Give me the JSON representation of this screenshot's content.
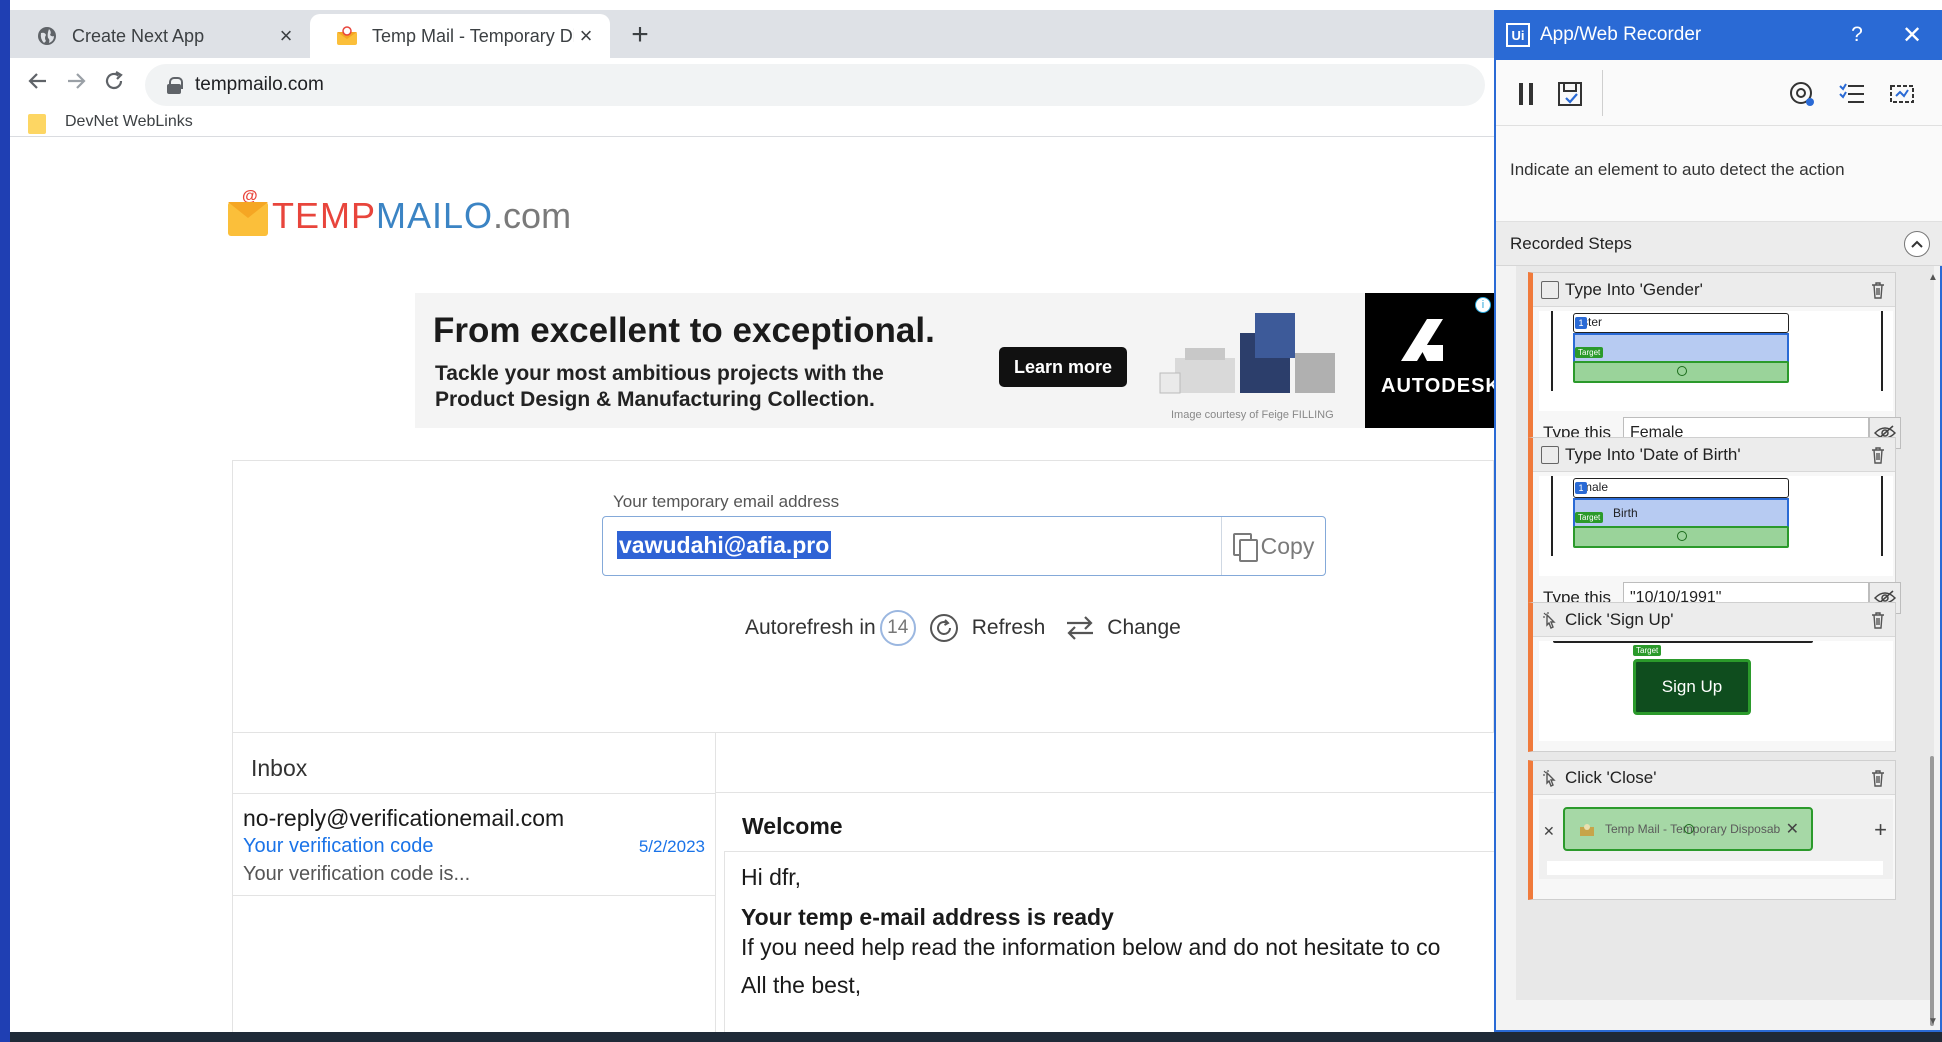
{
  "browser": {
    "tabs": [
      {
        "title": "Create Next App",
        "icon": "globe-icon",
        "active": false
      },
      {
        "title": "Temp Mail - Temporary Disposab",
        "icon": "envelope-icon",
        "active": true
      }
    ],
    "new_tab": "+",
    "url": "tempmailo.com",
    "bookmark": "DevNet WebLinks"
  },
  "page": {
    "logo": {
      "part1": "TEMP",
      "part2": "MAILO",
      "part3": ".com",
      "at": "@"
    },
    "ad": {
      "headline": "From excellent to exceptional.",
      "body": "Tackle your most ambitious projects with the Product Design & Manufacturing Collection.",
      "button": "Learn more",
      "credit": "Image courtesy of Feige FILLING",
      "brand": "AUTODESK",
      "info": "i"
    },
    "email": {
      "label": "Your temporary email address",
      "value": "vawudahi@afia.pro",
      "copy": "Copy"
    },
    "autorefresh": {
      "label": "Autorefresh in",
      "seconds": "14",
      "refresh": "Refresh",
      "change": "Change"
    },
    "inbox": {
      "title": "Inbox",
      "messages": [
        {
          "from": "no-reply@verificationemail.com",
          "subject": "Your verification code",
          "date": "5/2/2023",
          "snippet": "Your verification code is..."
        }
      ]
    },
    "message": {
      "subject": "Welcome",
      "greeting": "Hi dfr,",
      "heading": "Your temp e-mail address is ready",
      "line": "If you need help read the information below and do not hesitate to co",
      "closing": "All the best,"
    }
  },
  "recorder": {
    "title": "App/Web Recorder",
    "help": "?",
    "close": "✕",
    "hint": "Indicate an element to auto detect the action",
    "steps_title": "Recorded Steps",
    "steps": [
      {
        "title": "Type Into 'Gender'",
        "type_label": "Type this",
        "value": "Female",
        "preview_top": "ster",
        "preview_target": "Target"
      },
      {
        "title": "Type Into 'Date of Birth'",
        "type_label": "Type this",
        "value": "\"10/10/1991\"",
        "preview_top": "male",
        "preview_target": "Target",
        "preview_field": "Birth"
      },
      {
        "title": "Click 'Sign Up'",
        "button": "Sign Up",
        "preview_target": "Target"
      },
      {
        "title": "Click 'Close'",
        "tab_text": "Temp Mail - Temporary Disposab"
      }
    ]
  },
  "colors": {
    "accent": "#2a6ad5",
    "step_border": "#f07a3b",
    "target_green": "#2b9a2b",
    "link_blue": "#1a73e8"
  }
}
